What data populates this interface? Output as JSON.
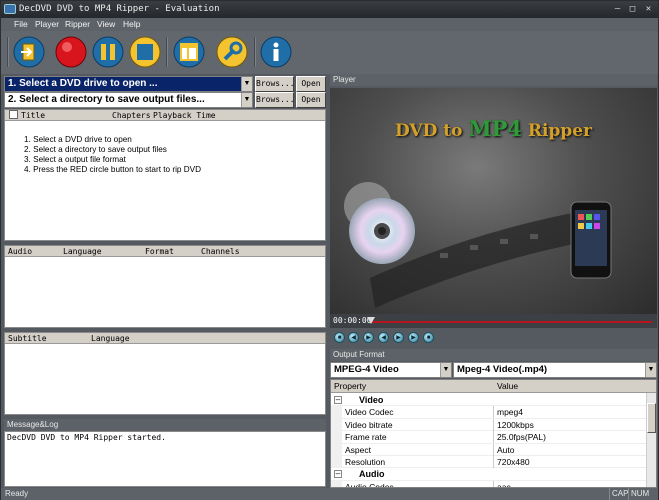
{
  "window": {
    "title": "DecDVD DVD to MP4 Ripper - Evaluation"
  },
  "menu": {
    "items": [
      "File",
      "Player",
      "Ripper",
      "View",
      "Help"
    ]
  },
  "toolbar": {
    "buttons": [
      "exit-icon",
      "record-icon",
      "pause-icon",
      "stop-icon",
      "layout-icon",
      "settings-icon",
      "info-icon"
    ]
  },
  "source": {
    "drive_label": "1. Select a DVD drive to open ...",
    "dir_label": "2. Select a directory to save output files...",
    "browse_label": "Brows...",
    "open_label": "Open"
  },
  "titles": {
    "columns": [
      "Title",
      "Chapters",
      "Playback Time"
    ],
    "instructions": [
      "1. Select a DVD drive to open",
      "2. Select a directory to save output files",
      "3. Select a output file format",
      "4. Press the RED circle button to start to rip DVD"
    ]
  },
  "audio": {
    "columns": [
      "Audio",
      "Language",
      "Format",
      "Channels"
    ]
  },
  "subtitle": {
    "columns": [
      "Subtitle",
      "Language"
    ]
  },
  "log": {
    "header": "Message&Log",
    "lines": [
      "DecDVD DVD to MP4 Ripper started."
    ]
  },
  "player": {
    "header": "Player",
    "video_title_a": "DVD to ",
    "video_title_b": "MP4",
    "video_title_c": " Ripper",
    "time": "00:00:00",
    "progress": 0
  },
  "output": {
    "header": "Output Format",
    "format": "MPEG-4 Video",
    "container": "Mpeg-4 Video(.mp4)",
    "columns": [
      "Property",
      "Value"
    ],
    "rows": [
      {
        "category": true,
        "key": "Video"
      },
      {
        "key": "Video Codec",
        "value": "mpeg4"
      },
      {
        "key": "Video bitrate",
        "value": "1200kbps"
      },
      {
        "key": "Frame rate",
        "value": "25.0fps(PAL)"
      },
      {
        "key": "Aspect",
        "value": "Auto"
      },
      {
        "key": "Resolution",
        "value": "720x480"
      },
      {
        "category": true,
        "key": "Audio"
      },
      {
        "key": "Audio Codec",
        "value": "aac"
      }
    ]
  },
  "status": {
    "text": "Ready",
    "cap": "CAP",
    "num": "NUM"
  },
  "colors": {
    "accent": "#0a246a",
    "record": "#d8141c",
    "toolbar_bg": "#62676d",
    "video_title": "#d4a02a",
    "video_mp4": "#2e9a38"
  }
}
